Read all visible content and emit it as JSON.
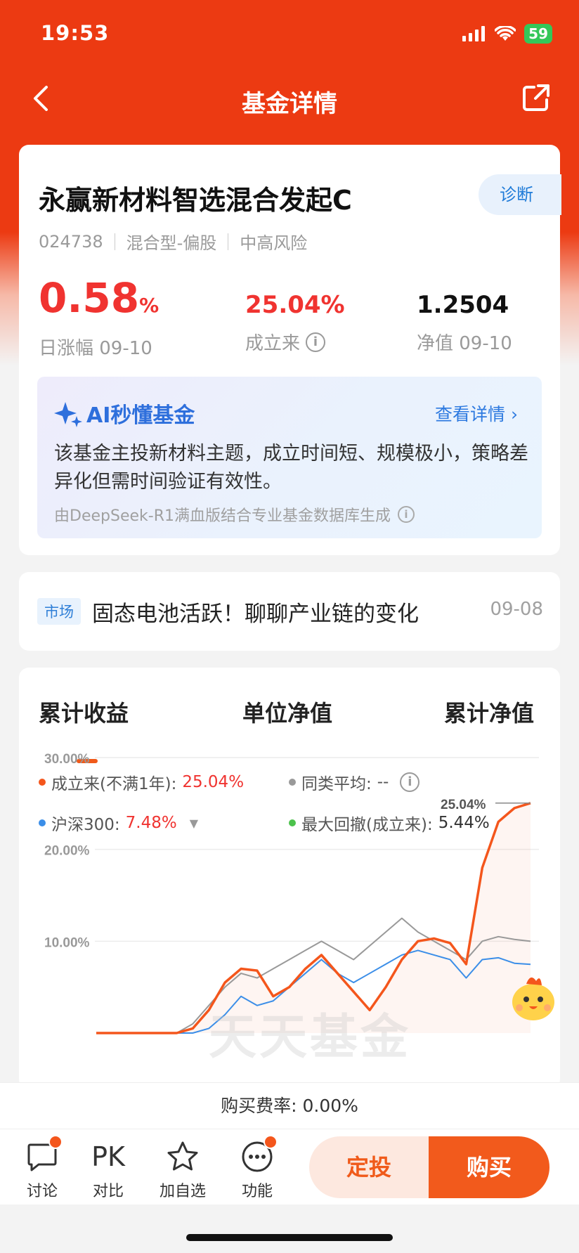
{
  "status_bar": {
    "time": "19:53",
    "battery": "59"
  },
  "nav": {
    "title": "基金详情"
  },
  "fund": {
    "name": "永赢新材料智选混合发起C",
    "diagnose_label": "诊断",
    "code": "024738",
    "type": "混合型-偏股",
    "risk": "中高风险",
    "daily_change_value": "0.58",
    "daily_change_unit": "%",
    "daily_change_label": "日涨幅 09-10",
    "since_inception_value": "25.04%",
    "since_inception_label": "成立来",
    "nav_value": "1.2504",
    "nav_label": "净值 09-10"
  },
  "ai": {
    "title": "AI秒懂基金",
    "more": "查看详情",
    "text": "该基金主投新材料主题，成立时间短、规模极小，策略差异化但需时间验证有效性。",
    "source": "由DeepSeek-R1满血版结合专业基金数据库生成"
  },
  "news": {
    "tag": "市场",
    "title": "固态电池活跃！聊聊产业链的变化",
    "date": "09-08"
  },
  "chart_tabs": [
    "累计收益",
    "单位净值",
    "累计净值"
  ],
  "legend": {
    "fund_label": "成立来(不满1年):",
    "fund_value": "25.04%",
    "peer_label": "同类平均:",
    "peer_value": "--",
    "index_label": "沪深300:",
    "index_value": "7.48%",
    "drawdown_label": "最大回撤(成立来):",
    "drawdown_value": "5.44%"
  },
  "chart_data": {
    "type": "line",
    "y_ticks": [
      "30.00%",
      "20.00%",
      "10.00%"
    ],
    "ylim": [
      0,
      30
    ],
    "end_label": "25.04%",
    "watermark": "天天基金",
    "series": [
      {
        "name": "成立来(不满1年)",
        "color": "#f4561c",
        "values": [
          0,
          0,
          0,
          0,
          0,
          0,
          0.5,
          2.5,
          5.5,
          7,
          6.8,
          4,
          5,
          7,
          8.5,
          6.5,
          4.5,
          2.5,
          5,
          8,
          10,
          10.3,
          9.8,
          7.5,
          18,
          23,
          24.5,
          25.04
        ]
      },
      {
        "name": "沪深300",
        "color": "#3b8ee8",
        "values": [
          0,
          0,
          0,
          0,
          0,
          0,
          0,
          0.5,
          2,
          4,
          3,
          3.5,
          5,
          6.5,
          8,
          6.5,
          5.5,
          6.5,
          7.5,
          8.5,
          9,
          8.5,
          8,
          6,
          8,
          8.2,
          7.6,
          7.48
        ]
      },
      {
        "name": "同类平均",
        "color": "#999999",
        "values": [
          0,
          0,
          0,
          0,
          0,
          0,
          1,
          3,
          5,
          6.5,
          6,
          7,
          8,
          9,
          10,
          9,
          8,
          9.5,
          11,
          12.5,
          11,
          10,
          9,
          8,
          10,
          10.5,
          10.2,
          10
        ]
      }
    ]
  },
  "fee": {
    "label": "购买费率:",
    "value": "0.00%"
  },
  "bottom": {
    "discuss": "讨论",
    "pk_icon": "PK",
    "compare": "对比",
    "watch": "加自选",
    "func": "功能",
    "dingtou": "定投",
    "buy": "购买"
  }
}
